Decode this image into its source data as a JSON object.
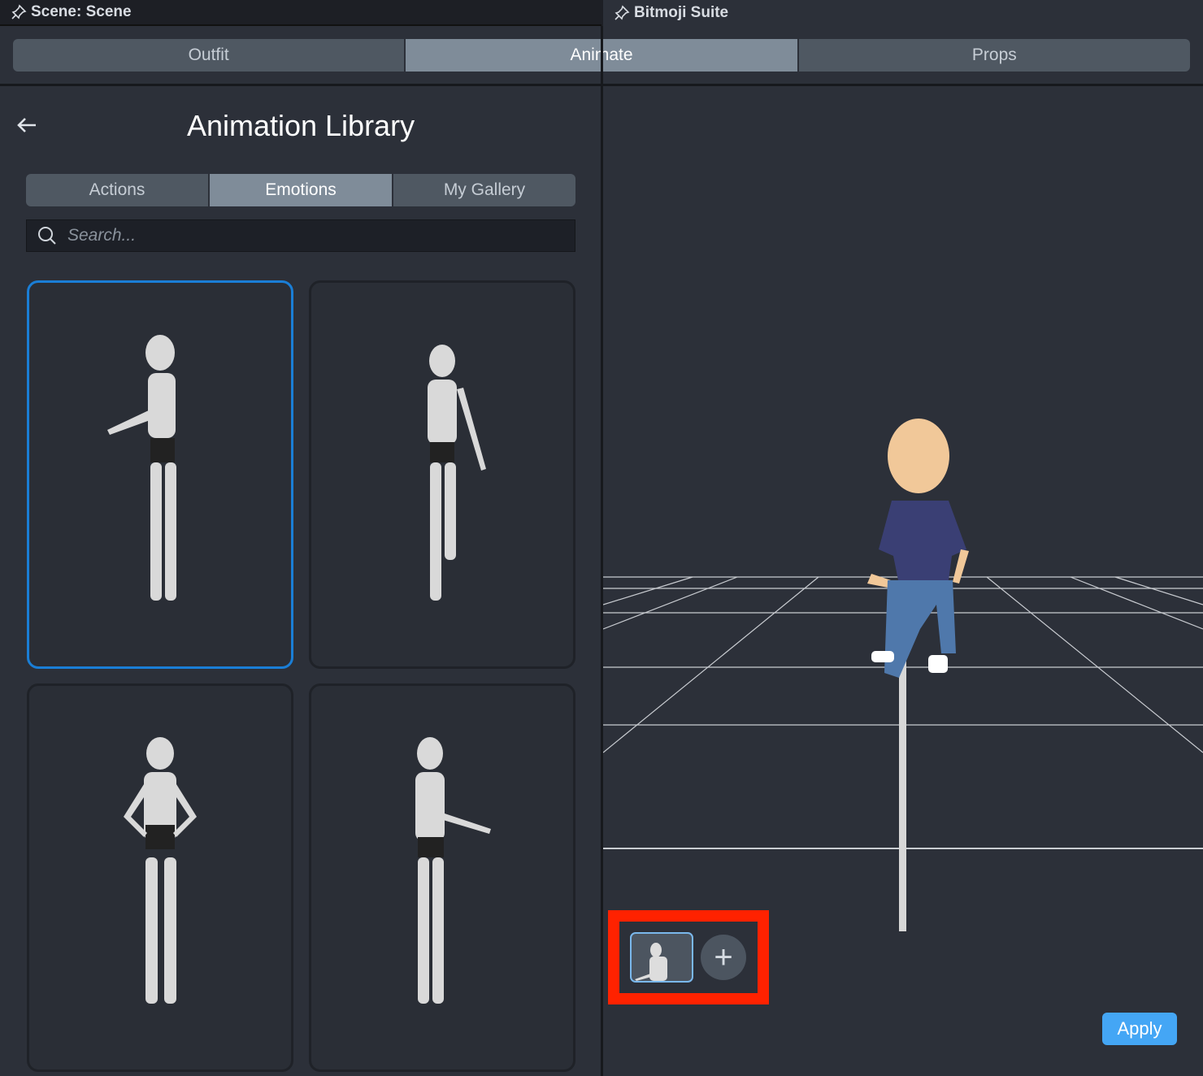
{
  "panels": {
    "scene_tab": "Scene: Scene",
    "bitmoji_tab": "Bitmoji Suite"
  },
  "main_tabs": [
    {
      "label": "Outfit"
    },
    {
      "label": "Animate",
      "active": true
    },
    {
      "label": "Props"
    }
  ],
  "library": {
    "title": "Animation Library",
    "sub_tabs": [
      {
        "label": "Actions"
      },
      {
        "label": "Emotions",
        "active": true
      },
      {
        "label": "My Gallery"
      }
    ],
    "search_placeholder": "Search...",
    "animations": [
      {
        "selected": true
      },
      {},
      {},
      {}
    ]
  },
  "viewport": {
    "add_label": "+",
    "apply_label": "Apply"
  },
  "colors": {
    "accent": "#44a6f5",
    "selection": "#1a7ed6",
    "highlight": "#ff2200"
  }
}
